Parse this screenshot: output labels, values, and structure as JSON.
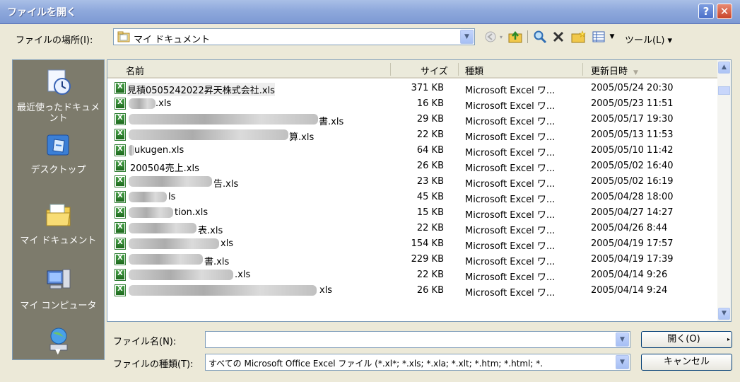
{
  "window": {
    "title": "ファイルを開く",
    "help_label": "?",
    "close_label": "✕"
  },
  "toolbar": {
    "lookin_label": "ファイルの場所(I):",
    "lookin_value": "マイ ドキュメント",
    "tools_label": "ツール(L) ▾"
  },
  "places": [
    {
      "label": "最近使ったドキュメント",
      "icon": "recent-documents-icon"
    },
    {
      "label": "デスクトップ",
      "icon": "desktop-icon"
    },
    {
      "label": "マイ ドキュメント",
      "icon": "my-documents-icon"
    },
    {
      "label": "マイ コンピュータ",
      "icon": "my-computer-icon"
    },
    {
      "label": "",
      "icon": "network-places-icon"
    }
  ],
  "columns": {
    "name": "名前",
    "size": "サイズ",
    "type": "種類",
    "date": "更新日時"
  },
  "files": [
    {
      "name": "見積0505242022昇天株式会社.xls",
      "size": "371 KB",
      "type": "Microsoft Excel ワ...",
      "date": "2005/05/24 20:30"
    },
    {
      "name": ".xls",
      "size": "16 KB",
      "type": "Microsoft Excel ワ...",
      "date": "2005/05/23 11:51"
    },
    {
      "name": "書.xls",
      "size": "29 KB",
      "type": "Microsoft Excel ワ...",
      "date": "2005/05/17 19:30"
    },
    {
      "name": "算.xls",
      "size": "22 KB",
      "type": "Microsoft Excel ワ...",
      "date": "2005/05/13 11:53"
    },
    {
      "name": "ukugen.xls",
      "size": "64 KB",
      "type": "Microsoft Excel ワ...",
      "date": "2005/05/10 11:42"
    },
    {
      "name": "200504売上.xls",
      "size": "26 KB",
      "type": "Microsoft Excel ワ...",
      "date": "2005/05/02 16:40"
    },
    {
      "name": "告.xls",
      "size": "23 KB",
      "type": "Microsoft Excel ワ...",
      "date": "2005/05/02 16:19"
    },
    {
      "name": "ls",
      "size": "45 KB",
      "type": "Microsoft Excel ワ...",
      "date": "2005/04/28 18:00"
    },
    {
      "name": "tion.xls",
      "size": "15 KB",
      "type": "Microsoft Excel ワ...",
      "date": "2005/04/27 14:27"
    },
    {
      "name": "表.xls",
      "size": "22 KB",
      "type": "Microsoft Excel ワ...",
      "date": "2005/04/26 8:44"
    },
    {
      "name": "xls",
      "size": "154 KB",
      "type": "Microsoft Excel ワ...",
      "date": "2005/04/19 17:57"
    },
    {
      "name": "書.xls",
      "size": "229 KB",
      "type": "Microsoft Excel ワ...",
      "date": "2005/04/19 17:39"
    },
    {
      "name": ".xls",
      "size": "22 KB",
      "type": "Microsoft Excel ワ...",
      "date": "2005/04/14 9:26"
    },
    {
      "name": "xls",
      "size": "26 KB",
      "type": "Microsoft Excel ワ...",
      "date": "2005/04/14 9:24"
    }
  ],
  "filename": {
    "label": "ファイル名(N):",
    "value": ""
  },
  "filetype": {
    "label": "ファイルの種類(T):",
    "value": "すべての Microsoft Office Excel ファイル (*.xl*; *.xls; *.xla; *.xlt; *.htm; *.html; *."
  },
  "buttons": {
    "open": "開く(O)",
    "cancel": "キャンセル"
  }
}
